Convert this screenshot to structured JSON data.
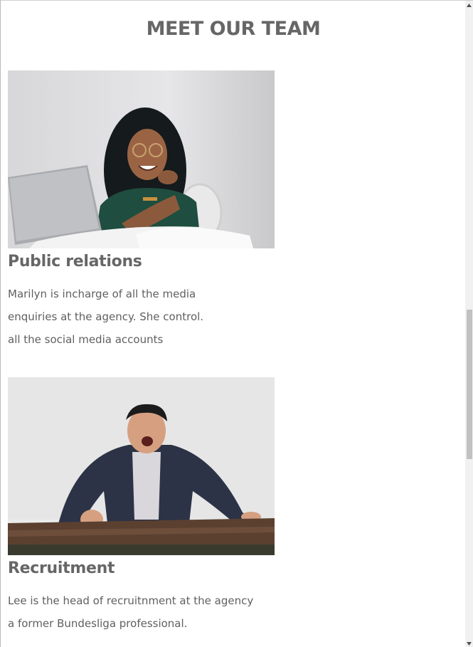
{
  "section": {
    "title": "MEET OUR TEAM"
  },
  "team": [
    {
      "role": "Public relations",
      "description_lines": [
        "Marilyn is incharge of all the media",
        "enquiries at the agency. She control.",
        "all the social media accounts"
      ]
    },
    {
      "role": "Recruitment",
      "description_lines": [
        "Lee is the head of recruitnment at the agency",
        "a former Bundesliga professional."
      ]
    }
  ],
  "colors": {
    "heading": "#666666",
    "text": "#606060",
    "scroll_track": "#f1f1f1",
    "scroll_thumb": "#c1c1c1"
  },
  "icons": {
    "scroll_up": "triangle-up-icon",
    "scroll_down": "triangle-down-icon"
  }
}
